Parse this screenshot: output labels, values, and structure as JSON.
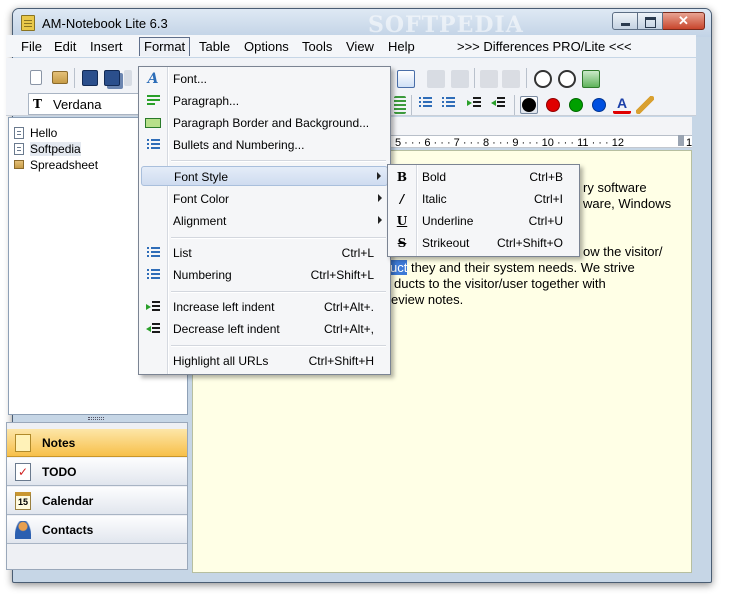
{
  "window": {
    "title": "AM-Notebook Lite  6.3",
    "watermark": "SOFTPEDIA"
  },
  "menubar": {
    "items": [
      "File",
      "Edit",
      "Insert",
      "Format",
      "Table",
      "Options",
      "Tools",
      "View",
      "Help"
    ],
    "differences": ">>> Differences PRO/Lite <<<"
  },
  "toolbar": {
    "font_name": "Verdana",
    "font_icon": "T"
  },
  "tree": {
    "items": [
      {
        "label": "Hello",
        "icon": "note-icon"
      },
      {
        "label": "Softpedia",
        "icon": "note-icon"
      },
      {
        "label": "Spreadsheet",
        "icon": "spreadsheet-icon"
      }
    ]
  },
  "nav": {
    "items": [
      {
        "label": "Notes",
        "icon": "notes-icon",
        "active": true
      },
      {
        "label": "TODO",
        "icon": "todo-icon",
        "active": false
      },
      {
        "label": "Calendar",
        "icon": "calendar-icon",
        "day": "15",
        "active": false
      },
      {
        "label": "Contacts",
        "icon": "contacts-icon",
        "active": false
      }
    ]
  },
  "ruler": {
    "text": "5 · · · 6 · · · 7 · · · 8 · · · 9 · · · 10 · · · 11 · · · 12",
    "tail": "1"
  },
  "document": {
    "lines": [
      "ry software",
      "ware, Windows",
      "",
      "ow the visitor/",
      "they and their system needs. We strive",
      "ducts to the visitor/user together with",
      "eview notes."
    ],
    "selected_fragment": "uct"
  },
  "format_menu": {
    "items": [
      {
        "label": "Font...",
        "icon": "font-icon",
        "shortcut": ""
      },
      {
        "label": "Paragraph...",
        "icon": "paragraph-icon",
        "shortcut": ""
      },
      {
        "label": "Paragraph Border and Background...",
        "icon": "border-icon",
        "shortcut": ""
      },
      {
        "label": "Bullets and Numbering...",
        "icon": "bullets-icon",
        "shortcut": ""
      },
      {
        "label": "Font Style",
        "icon": "",
        "shortcut": "",
        "submenu": true
      },
      {
        "label": "Font Color",
        "icon": "",
        "shortcut": "",
        "submenu": true
      },
      {
        "label": "Alignment",
        "icon": "",
        "shortcut": "",
        "submenu": true
      },
      {
        "label": "List",
        "icon": "list-icon",
        "shortcut": "Ctrl+L"
      },
      {
        "label": "Numbering",
        "icon": "numbering-icon",
        "shortcut": "Ctrl+Shift+L"
      },
      {
        "label": "Increase left indent",
        "icon": "indent-increase-icon",
        "shortcut": "Ctrl+Alt+."
      },
      {
        "label": "Decrease left indent",
        "icon": "indent-decrease-icon",
        "shortcut": "Ctrl+Alt+,"
      },
      {
        "label": "Highlight all URLs",
        "icon": "",
        "shortcut": "Ctrl+Shift+H"
      }
    ]
  },
  "font_style_menu": {
    "items": [
      {
        "label": "Bold",
        "icon_text": "B",
        "shortcut": "Ctrl+B"
      },
      {
        "label": "Italic",
        "icon_text": "/",
        "shortcut": "Ctrl+I"
      },
      {
        "label": "Underline",
        "icon_text": "U",
        "shortcut": "Ctrl+U"
      },
      {
        "label": "Strikeout",
        "icon_text": "S",
        "shortcut": "Ctrl+Shift+O"
      }
    ]
  },
  "colors": {
    "color_buttons": [
      "#000000",
      "#e00000",
      "#00a000",
      "#0050e0"
    ],
    "nav_active": "#f7c04a",
    "editor_bg": "#ffffe6",
    "selection": "#3d7ad6"
  }
}
